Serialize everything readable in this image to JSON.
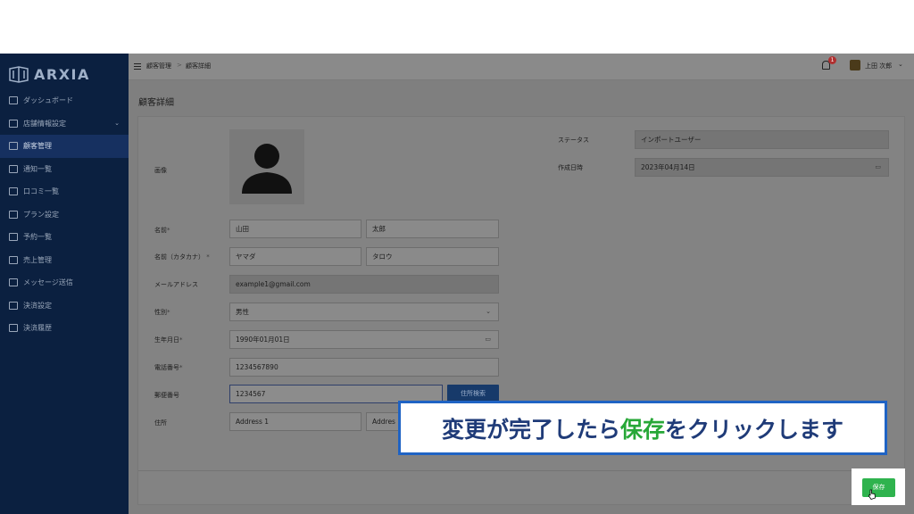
{
  "brand": {
    "name": "ARXIA"
  },
  "sidebar": {
    "items": [
      {
        "label": "ダッシュボード",
        "icon": "dashboard-icon"
      },
      {
        "label": "店舗情報設定",
        "icon": "store-icon",
        "has_chevron": true
      },
      {
        "label": "顧客管理",
        "icon": "users-icon",
        "active": true
      },
      {
        "label": "通知一覧",
        "icon": "notification-icon"
      },
      {
        "label": "口コミ一覧",
        "icon": "review-icon"
      },
      {
        "label": "プラン設定",
        "icon": "plan-icon"
      },
      {
        "label": "予約一覧",
        "icon": "calendar-icon"
      },
      {
        "label": "売上管理",
        "icon": "money-icon"
      },
      {
        "label": "メッセージ送信",
        "icon": "mail-icon"
      },
      {
        "label": "決済設定",
        "icon": "card-icon"
      },
      {
        "label": "決済履歴",
        "icon": "history-icon"
      }
    ]
  },
  "topbar": {
    "breadcrumb": [
      "顧客管理",
      "顧客詳細"
    ],
    "breadcrumb_separator": ">",
    "notification_count": "1",
    "user_name": "上田 次郎"
  },
  "page": {
    "title": "顧客詳細"
  },
  "form": {
    "image_label": "画像",
    "name_label": "名前",
    "name_last": "山田",
    "name_first": "太郎",
    "kana_label": "名前（カタカナ）",
    "kana_last": "ヤマダ",
    "kana_first": "タロウ",
    "email_label": "メールアドレス",
    "email": "example1@gmail.com",
    "gender_label": "性別",
    "gender": "男性",
    "birth_label": "生年月日",
    "birth": "1990年01月01日",
    "phone_label": "電話番号",
    "phone": "1234567890",
    "zip_label": "郵便番号",
    "zip": "1234567",
    "zip_search_button": "住所検索",
    "address_label": "住所",
    "address1": "Address 1",
    "address2": "Addres",
    "required_mark": "*",
    "status_label": "ステータス",
    "status": "インポートユーザー",
    "created_label": "作成日時",
    "created": "2023年04月14日"
  },
  "callout": {
    "before": "変更が完了したら",
    "highlight": "保存",
    "after": "をクリックします",
    "highlight_color": "#27a737"
  },
  "footer": {
    "save_button": "保存",
    "save_color": "#2fb34e"
  }
}
